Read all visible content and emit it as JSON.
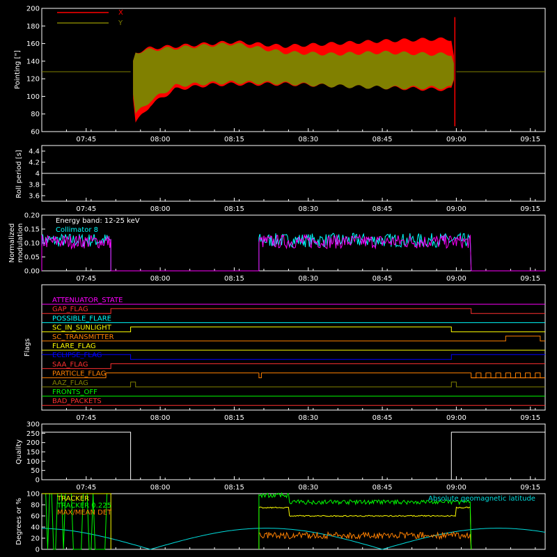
{
  "chart_data": [
    {
      "type": "line",
      "ylabel": "Pointing [\"]",
      "ylim": [
        60,
        200
      ],
      "yticks": [
        60,
        80,
        100,
        120,
        140,
        160,
        180,
        200
      ],
      "xlim": [
        "07:36",
        "09:18"
      ],
      "xticks": [
        "07:45",
        "08:00",
        "08:15",
        "08:30",
        "08:45",
        "09:00",
        "09:15"
      ],
      "legend_placement": "top-left",
      "series": [
        {
          "name": "X",
          "color": "#ff0000",
          "x": [
            "07:36",
            "07:54",
            "07:55",
            "07:58",
            "08:03",
            "08:10",
            "08:15",
            "08:25",
            "08:35",
            "08:45",
            "08:55",
            "08:59",
            "09:00",
            "09:18"
          ],
          "y_min": [
            128,
            128,
            70,
            90,
            108,
            113,
            114,
            114,
            112,
            110,
            108,
            108,
            128,
            128
          ],
          "y_max": [
            128,
            128,
            150,
            155,
            157,
            160,
            162,
            157,
            160,
            163,
            165,
            165,
            128,
            128
          ]
        },
        {
          "name": "Y",
          "color": "#808000",
          "x": [
            "07:36",
            "07:54",
            "07:55",
            "07:58",
            "08:03",
            "08:10",
            "08:15",
            "08:25",
            "08:35",
            "08:45",
            "08:55",
            "08:59",
            "09:00",
            "09:18"
          ],
          "y_min": [
            128,
            128,
            80,
            95,
            112,
            115,
            116,
            115,
            112,
            110,
            110,
            110,
            128,
            128
          ],
          "y_max": [
            128,
            128,
            150,
            153,
            155,
            158,
            160,
            150,
            148,
            150,
            148,
            148,
            128,
            128
          ]
        }
      ]
    },
    {
      "type": "line",
      "ylabel": "Roll period [s]",
      "ylim": [
        3.5,
        4.5
      ],
      "yticks": [
        3.6,
        3.8,
        4.0,
        4.2,
        4.4
      ],
      "xticks": [
        "07:45",
        "08:00",
        "08:15",
        "08:30",
        "08:45",
        "09:00",
        "09:15"
      ],
      "series": [
        {
          "color": "#ffffff",
          "x": [
            "07:36",
            "09:18"
          ],
          "y": [
            4.0,
            4.0
          ]
        }
      ]
    },
    {
      "type": "line",
      "ylabel": "Normalized modulation",
      "ylim": [
        0,
        0.2
      ],
      "yticks": [
        "0.00",
        "0.05",
        "0.10",
        "0.15",
        "0.20"
      ],
      "xticks": [
        "07:45",
        "08:00",
        "08:15",
        "08:30",
        "08:45",
        "09:00",
        "09:15"
      ],
      "annotations": [
        "Energy band: 12-25 keV",
        "Collimator 8"
      ],
      "series": [
        {
          "color": "#00ffff",
          "segments": [
            [
              "07:36",
              "07:50"
            ],
            [
              "08:20",
              "09:03"
            ]
          ],
          "mean": 0.11,
          "spread": 0.025
        },
        {
          "color": "#ff00ff",
          "segments": [
            [
              "07:36",
              "07:50"
            ],
            [
              "08:20",
              "09:03"
            ]
          ],
          "mean": 0.105,
          "spread": 0.025
        }
      ]
    },
    {
      "type": "line",
      "ylabel": "Flags",
      "xticks": [
        "07:45",
        "08:00",
        "08:15",
        "08:30",
        "08:45",
        "09:00",
        "09:15"
      ],
      "series": [
        {
          "name": "ATTENUATOR_STATE",
          "color": "#ff00ff",
          "steps": [
            [
              "07:36",
              0
            ]
          ]
        },
        {
          "name": "GAP_FLAG",
          "color": "#ff3030",
          "steps": [
            [
              "07:36",
              0
            ],
            [
              "07:50",
              1
            ],
            [
              "09:03",
              0
            ],
            [
              "09:18",
              0
            ]
          ]
        },
        {
          "name": "POSSIBLE_FLARE",
          "color": "#00ffff",
          "steps": [
            [
              "07:36",
              0
            ]
          ]
        },
        {
          "name": "SC_IN_SUNLIGHT",
          "color": "#ffff00",
          "steps": [
            [
              "07:36",
              0
            ],
            [
              "07:54",
              1
            ],
            [
              "08:59",
              0
            ]
          ]
        },
        {
          "name": "SC_TRANSMITTER",
          "color": "#ff8000",
          "steps": [
            [
              "07:36",
              0
            ],
            [
              "09:10",
              1
            ],
            [
              "09:17",
              0
            ]
          ]
        },
        {
          "name": "FLARE_FLAG",
          "color": "#ffff00",
          "steps": [
            [
              "07:36",
              0
            ]
          ]
        },
        {
          "name": "ECLIPSE_FLAG",
          "color": "#0000ff",
          "steps": [
            [
              "07:36",
              1
            ],
            [
              "07:54",
              0
            ],
            [
              "08:59",
              1
            ]
          ]
        },
        {
          "name": "SAA_FLAG",
          "color": "#ff3030",
          "steps": [
            [
              "07:36",
              0
            ],
            [
              "07:50",
              1
            ],
            [
              "09:18",
              1
            ]
          ]
        },
        {
          "name": "PARTICLE_FLAG",
          "color": "#ff8000",
          "steps": [
            [
              "07:36",
              0
            ],
            [
              "07:49",
              1
            ],
            [
              "08:20",
              0
            ],
            [
              "08:20.5",
              1
            ],
            [
              "09:03",
              0
            ]
          ]
        },
        {
          "name": "AAZ_FLAG",
          "color": "#808000",
          "steps": [
            [
              "07:36",
              0
            ],
            [
              "07:54",
              1
            ],
            [
              "07:55",
              0
            ],
            [
              "08:59",
              1
            ],
            [
              "09:00",
              0
            ]
          ]
        },
        {
          "name": "FRONTS_OFF",
          "color": "#00ff00",
          "steps": [
            [
              "07:36",
              0
            ]
          ]
        },
        {
          "name": "BAD_PACKETS",
          "color": "#ff3030",
          "steps": [
            [
              "07:36",
              0
            ]
          ]
        }
      ]
    },
    {
      "type": "line",
      "ylabel": "Quality",
      "ylim": [
        0,
        300
      ],
      "yticks": [
        0,
        50,
        100,
        150,
        200,
        250,
        300
      ],
      "xticks": [
        "07:45",
        "08:00",
        "08:15",
        "08:30",
        "08:45",
        "09:00",
        "09:15"
      ],
      "series": [
        {
          "color": "#ffffff",
          "x": [
            "07:36",
            "07:54",
            "07:54",
            "08:59",
            "08:59",
            "09:18"
          ],
          "y": [
            256,
            256,
            0,
            0,
            256,
            256
          ]
        }
      ]
    },
    {
      "type": "line",
      "ylabel": "Degrees or %",
      "ylim": [
        0,
        100
      ],
      "yticks": [
        0,
        20,
        40,
        60,
        80,
        100
      ],
      "annotations": [
        "Absolute geomagnetic latitude"
      ],
      "legend_entries": [
        "TRACKER",
        "TRACKER 0.225",
        "MAX/MEAN DET"
      ],
      "series": [
        {
          "name": "Absolute geomagnetic latitude",
          "color": "#00dddd"
        },
        {
          "name": "TRACKER",
          "color": "#ffff00"
        },
        {
          "name": "TRACKER 0.225",
          "color": "#00ff00"
        },
        {
          "name": "MAX/MEAN DET",
          "color": "#ff8000"
        }
      ]
    }
  ]
}
